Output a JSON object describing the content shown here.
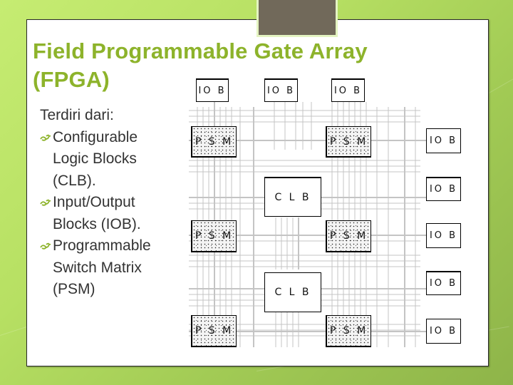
{
  "slide": {
    "title": "Field Programmable Gate Array (FPGA)",
    "title_line1": "Field Programmable Gate Array",
    "title_line2": "(FPGA)",
    "intro": "Terdiri dari:",
    "bullets": [
      {
        "icon": "leaf-ornament-icon",
        "line1": "Configurable",
        "line2": "Logic Blocks",
        "line3": "(CLB)."
      },
      {
        "icon": "leaf-ornament-icon",
        "line1": "Input/Output",
        "line2": "Blocks (IOB).",
        "line3": ""
      },
      {
        "icon": "leaf-ornament-icon",
        "line1": "Programmable",
        "line2": "Switch Matrix",
        "line3": "(PSM)"
      }
    ],
    "colors": {
      "title": "#8db32b",
      "header_tab": "#71695a",
      "background": "#b7e063",
      "bullet_ornament": "#8db32b"
    }
  },
  "diagram": {
    "iob_label": "IO B",
    "psm_label": "P S M",
    "clb_label": "C L B",
    "top_iobs": [
      "IO B",
      "IO B",
      "IO B"
    ],
    "right_iobs": [
      "IO B",
      "IO B",
      "IO B",
      "IO B",
      "IO B"
    ],
    "psms": [
      "P S M",
      "P S M",
      "P S M",
      "P S M",
      "P S M",
      "P S M"
    ],
    "clbs": [
      "C L B",
      "C L B"
    ]
  }
}
